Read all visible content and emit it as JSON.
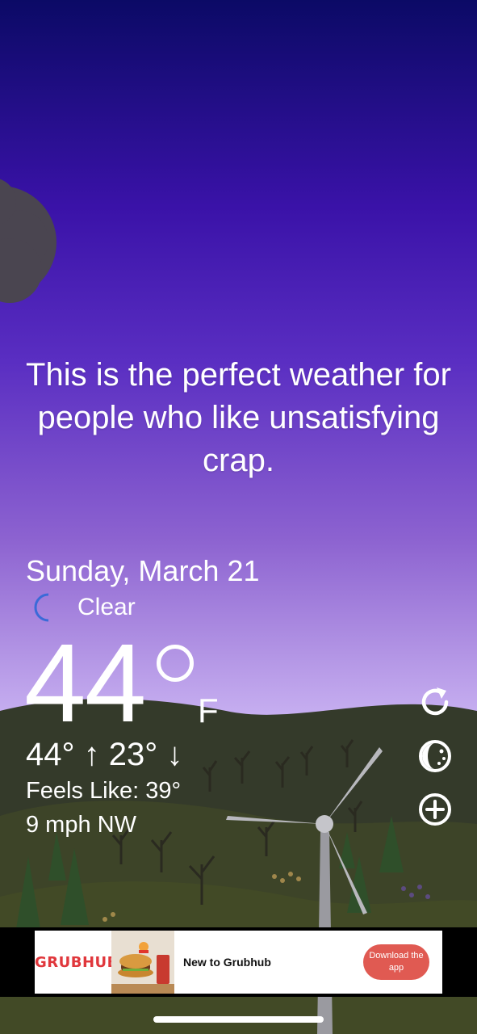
{
  "quote": "This is the perfect weather for people who like unsatisfying crap.",
  "date": "Sunday, March 21",
  "condition": "Clear",
  "condition_icon": "moon-icon",
  "temperature": "44",
  "unit": "F",
  "high_low": "44° ↑  23° ↓",
  "feels_like": "Feels Like: 39°",
  "wind": "9 mph NW",
  "side_buttons": [
    {
      "icon": "refresh-icon"
    },
    {
      "icon": "moon-phase-icon"
    },
    {
      "icon": "add-icon"
    }
  ],
  "ad": {
    "brand": "GRUBHUB",
    "text": "New to Grubhub",
    "cta": "Download the app"
  },
  "colors": {
    "sky_top": "#0b0a66",
    "sky_bottom": "#cdbff4",
    "hills": "#3a3f2a",
    "ad_brand": "#e0373c",
    "ad_button": "#e05a52"
  }
}
